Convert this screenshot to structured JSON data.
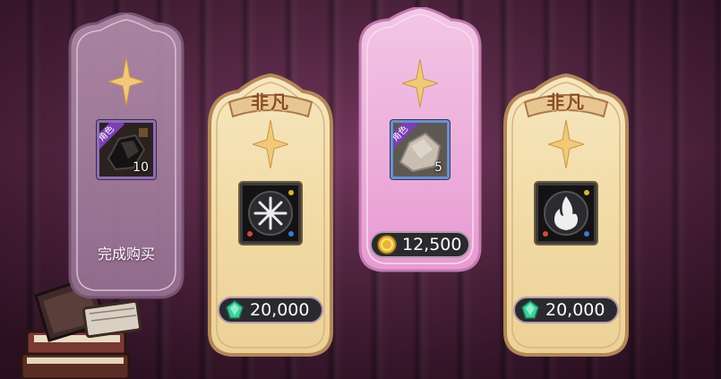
{
  "shop": {
    "cards": [
      {
        "id": "card-1",
        "style": "purple-sold",
        "item": {
          "tag": "角色",
          "quantity": "10",
          "icon": "dark-fragment-icon"
        },
        "status": "完成购买"
      },
      {
        "id": "card-2",
        "style": "gold",
        "banner": "非凡",
        "item": {
          "icon": "snowflake-emblem-icon"
        },
        "price": {
          "currency": "green-gem",
          "amount": "20,000"
        }
      },
      {
        "id": "card-3",
        "style": "pink",
        "item": {
          "tag": "角色",
          "quantity": "5",
          "icon": "stone-fragment-icon"
        },
        "price": {
          "currency": "gold-coin",
          "amount": "12,500"
        }
      },
      {
        "id": "card-4",
        "style": "gold",
        "banner": "非凡",
        "item": {
          "icon": "flame-emblem-icon"
        },
        "price": {
          "currency": "green-gem",
          "amount": "20,000"
        }
      }
    ]
  },
  "colors": {
    "background": "#5a2346",
    "gold_card": "#f3dfb0",
    "pink_card": "#e9a7d8",
    "purple_card": "#a17a9c",
    "rarity_purple": "#7c3fb3",
    "price_pill": "#2a2a2e"
  }
}
